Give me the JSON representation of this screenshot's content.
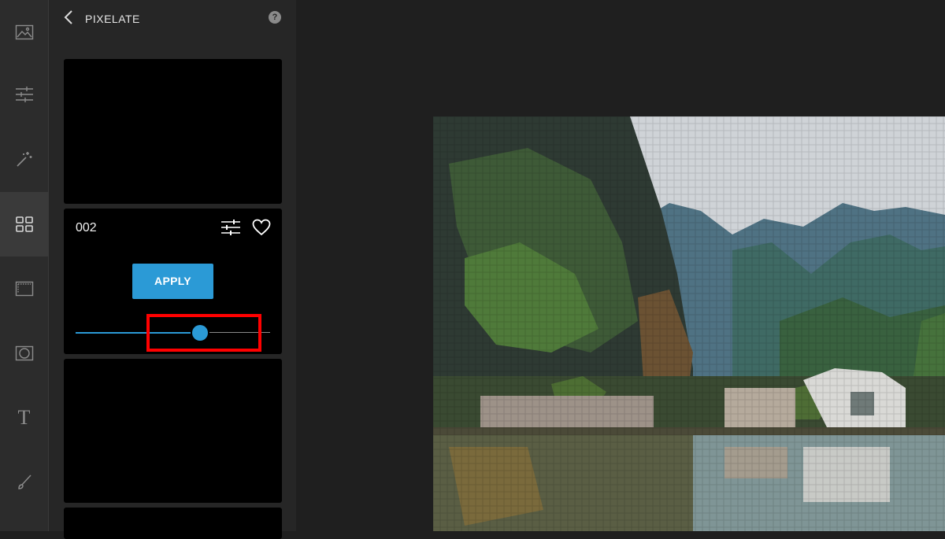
{
  "toolbar": {
    "tools": [
      {
        "name": "image-icon",
        "active": false
      },
      {
        "name": "adjust-sliders-icon",
        "active": false
      },
      {
        "name": "magic-wand-icon",
        "active": false
      },
      {
        "name": "grid-effects-icon",
        "active": true
      },
      {
        "name": "frame-icon",
        "active": false
      },
      {
        "name": "vignette-icon",
        "active": false
      },
      {
        "name": "text-icon",
        "active": false
      },
      {
        "name": "brush-icon",
        "active": false
      }
    ],
    "text_glyph": "T"
  },
  "panel": {
    "title": "PIXELATE",
    "help_glyph": "?",
    "cards": [
      {
        "name": ""
      },
      {
        "name": "002",
        "apply_label": "APPLY",
        "slider_value": 0.64
      },
      {
        "name": ""
      },
      {
        "name": ""
      }
    ]
  },
  "colors": {
    "accent": "#2b9ad6",
    "highlight": "#ff0000"
  }
}
